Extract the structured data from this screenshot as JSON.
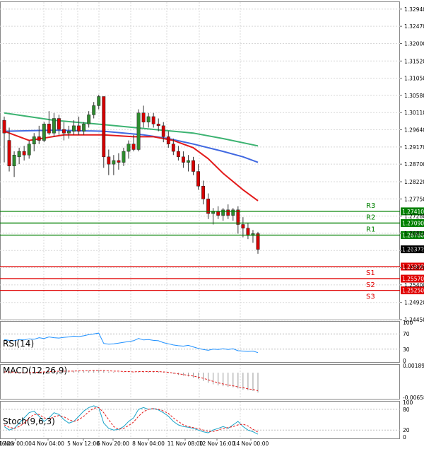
{
  "chart_data": {
    "type": "candlestick",
    "grid": true,
    "price_axis": {
      "ylim": [
        1.2445,
        1.3315
      ],
      "tick_labels": [
        "1.32940",
        "1.32470",
        "1.32000",
        "1.31520",
        "1.31050",
        "1.30580",
        "1.30110",
        "1.29640",
        "1.29170",
        "1.28700",
        "1.28220",
        "1.27750",
        "1.27280",
        "1.26810",
        "1.26340",
        "1.25870",
        "1.25400",
        "1.24920",
        "1.24450"
      ]
    },
    "x_tick_labels": [
      "1 Nov 00:00",
      "4 Nov 04:00",
      "5 Nov 12:00",
      "6 Nov 20:00",
      "8 Nov 04:00",
      "11 Nov 08:00",
      "12 Nov 16:00",
      "14 Nov 00:00"
    ],
    "x_left_partial_label": "16:00",
    "candles": [
      {
        "o": 1.299,
        "h": 1.3,
        "l": 1.2875,
        "c": 1.2955
      },
      {
        "o": 1.2935,
        "h": 1.297,
        "l": 1.285,
        "c": 1.2865
      },
      {
        "o": 1.2865,
        "h": 1.2905,
        "l": 1.2835,
        "c": 1.2895
      },
      {
        "o": 1.289,
        "h": 1.2915,
        "l": 1.287,
        "c": 1.2905
      },
      {
        "o": 1.2905,
        "h": 1.292,
        "l": 1.288,
        "c": 1.2895
      },
      {
        "o": 1.2895,
        "h": 1.2935,
        "l": 1.2885,
        "c": 1.2925
      },
      {
        "o": 1.2925,
        "h": 1.2955,
        "l": 1.2905,
        "c": 1.2945
      },
      {
        "o": 1.2945,
        "h": 1.2975,
        "l": 1.2925,
        "c": 1.2935
      },
      {
        "o": 1.2935,
        "h": 1.2985,
        "l": 1.293,
        "c": 1.298
      },
      {
        "o": 1.298,
        "h": 1.3015,
        "l": 1.295,
        "c": 1.2955
      },
      {
        "o": 1.2955,
        "h": 1.301,
        "l": 1.2945,
        "c": 1.2995
      },
      {
        "o": 1.2995,
        "h": 1.3005,
        "l": 1.295,
        "c": 1.2965
      },
      {
        "o": 1.2965,
        "h": 1.2985,
        "l": 1.2935,
        "c": 1.2955
      },
      {
        "o": 1.2955,
        "h": 1.2975,
        "l": 1.294,
        "c": 1.296
      },
      {
        "o": 1.296,
        "h": 1.299,
        "l": 1.295,
        "c": 1.2975
      },
      {
        "o": 1.2975,
        "h": 1.3,
        "l": 1.295,
        "c": 1.296
      },
      {
        "o": 1.296,
        "h": 1.2985,
        "l": 1.295,
        "c": 1.298
      },
      {
        "o": 1.298,
        "h": 1.3015,
        "l": 1.297,
        "c": 1.3005
      },
      {
        "o": 1.3005,
        "h": 1.304,
        "l": 1.2995,
        "c": 1.303
      },
      {
        "o": 1.303,
        "h": 1.306,
        "l": 1.302,
        "c": 1.3055
      },
      {
        "o": 1.3055,
        "h": 1.3055,
        "l": 1.286,
        "c": 1.289
      },
      {
        "o": 1.289,
        "h": 1.291,
        "l": 1.284,
        "c": 1.287
      },
      {
        "o": 1.287,
        "h": 1.2895,
        "l": 1.284,
        "c": 1.288
      },
      {
        "o": 1.288,
        "h": 1.29,
        "l": 1.2855,
        "c": 1.2875
      },
      {
        "o": 1.2875,
        "h": 1.2915,
        "l": 1.2865,
        "c": 1.2905
      },
      {
        "o": 1.2905,
        "h": 1.2935,
        "l": 1.2885,
        "c": 1.2925
      },
      {
        "o": 1.2925,
        "h": 1.295,
        "l": 1.2905,
        "c": 1.291
      },
      {
        "o": 1.291,
        "h": 1.302,
        "l": 1.2905,
        "c": 1.301
      },
      {
        "o": 1.301,
        "h": 1.303,
        "l": 1.297,
        "c": 1.2985
      },
      {
        "o": 1.2985,
        "h": 1.301,
        "l": 1.297,
        "c": 1.3
      },
      {
        "o": 1.3,
        "h": 1.301,
        "l": 1.297,
        "c": 1.298
      },
      {
        "o": 1.298,
        "h": 1.2995,
        "l": 1.296,
        "c": 1.2975
      },
      {
        "o": 1.2975,
        "h": 1.2985,
        "l": 1.293,
        "c": 1.2945
      },
      {
        "o": 1.2945,
        "h": 1.296,
        "l": 1.2915,
        "c": 1.2925
      },
      {
        "o": 1.2925,
        "h": 1.294,
        "l": 1.2895,
        "c": 1.2905
      },
      {
        "o": 1.2905,
        "h": 1.292,
        "l": 1.288,
        "c": 1.289
      },
      {
        "o": 1.289,
        "h": 1.2905,
        "l": 1.286,
        "c": 1.2875
      },
      {
        "o": 1.2875,
        "h": 1.2895,
        "l": 1.285,
        "c": 1.288
      },
      {
        "o": 1.288,
        "h": 1.289,
        "l": 1.284,
        "c": 1.285
      },
      {
        "o": 1.285,
        "h": 1.287,
        "l": 1.28,
        "c": 1.281
      },
      {
        "o": 1.281,
        "h": 1.2825,
        "l": 1.276,
        "c": 1.2775
      },
      {
        "o": 1.2775,
        "h": 1.279,
        "l": 1.272,
        "c": 1.2735
      },
      {
        "o": 1.2735,
        "h": 1.275,
        "l": 1.2705,
        "c": 1.274
      },
      {
        "o": 1.274,
        "h": 1.2755,
        "l": 1.272,
        "c": 1.273
      },
      {
        "o": 1.273,
        "h": 1.275,
        "l": 1.2715,
        "c": 1.2745
      },
      {
        "o": 1.2745,
        "h": 1.276,
        "l": 1.272,
        "c": 1.273
      },
      {
        "o": 1.273,
        "h": 1.275,
        "l": 1.2715,
        "c": 1.2745
      },
      {
        "o": 1.2745,
        "h": 1.2755,
        "l": 1.268,
        "c": 1.2705
      },
      {
        "o": 1.2705,
        "h": 1.2725,
        "l": 1.267,
        "c": 1.2695
      },
      {
        "o": 1.2695,
        "h": 1.271,
        "l": 1.2665,
        "c": 1.2675
      },
      {
        "o": 1.2675,
        "h": 1.269,
        "l": 1.2655,
        "c": 1.268
      },
      {
        "o": 1.268,
        "h": 1.2685,
        "l": 1.2625,
        "c": 1.2637
      }
    ],
    "moving_averages": [
      {
        "color": "#3cb371",
        "points": [
          [
            0,
            1.301
          ],
          [
            10,
            1.299
          ],
          [
            20,
            1.2978
          ],
          [
            30,
            1.2965
          ],
          [
            38,
            1.2955
          ],
          [
            44,
            1.294
          ],
          [
            51,
            1.292
          ]
        ]
      },
      {
        "color": "#4169e1",
        "points": [
          [
            0,
            1.296
          ],
          [
            10,
            1.2963
          ],
          [
            20,
            1.296
          ],
          [
            28,
            1.295
          ],
          [
            33,
            1.294
          ],
          [
            38,
            1.2925
          ],
          [
            44,
            1.2905
          ],
          [
            48,
            1.289
          ],
          [
            51,
            1.2875
          ]
        ]
      },
      {
        "color": "#e31b1b",
        "points": [
          [
            0,
            1.296
          ],
          [
            5,
            1.2935
          ],
          [
            12,
            1.295
          ],
          [
            20,
            1.295
          ],
          [
            26,
            1.2945
          ],
          [
            30,
            1.2945
          ],
          [
            34,
            1.2935
          ],
          [
            38,
            1.2915
          ],
          [
            41,
            1.2885
          ],
          [
            44,
            1.2845
          ],
          [
            48,
            1.28
          ],
          [
            51,
            1.277
          ]
        ]
      }
    ],
    "levels": [
      {
        "name": "R3",
        "price_label": "1.27410",
        "value": 1.2741,
        "color": "#008000"
      },
      {
        "name": "R2",
        "price_label": "1.27090",
        "value": 1.2709,
        "color": "#008000"
      },
      {
        "name": "R1",
        "price_label": "1.26760",
        "value": 1.2676,
        "color": "#008000"
      },
      {
        "name": "S1",
        "price_label": "1.25900",
        "value": 1.259,
        "color": "#e00000"
      },
      {
        "name": "S2",
        "price_label": "1.25570",
        "value": 1.2557,
        "color": "#e00000"
      },
      {
        "name": "S3",
        "price_label": "1.25250",
        "value": 1.2525,
        "color": "#e00000"
      }
    ],
    "current_price": {
      "label": "1.26372",
      "value": 1.26372
    },
    "rsi": {
      "label": "RSI(14)",
      "ylim": [
        0,
        100
      ],
      "tick_labels": [
        "100",
        "70",
        "30",
        "0"
      ],
      "tick_values": [
        100,
        70,
        30,
        0
      ],
      "values": [
        55,
        53,
        52,
        55,
        54,
        57,
        56,
        60,
        58,
        62,
        60,
        59,
        61,
        62,
        64,
        63,
        65,
        68,
        70,
        72,
        45,
        43,
        44,
        46,
        48,
        50,
        52,
        58,
        54,
        55,
        53,
        52,
        47,
        44,
        41,
        39,
        38,
        40,
        36,
        32,
        29,
        27,
        30,
        29,
        31,
        29,
        31,
        26,
        25,
        24,
        25,
        21
      ]
    },
    "macd": {
      "label": "MACD(12,26,9)",
      "tick_labels": [
        "0.001899",
        "-0.006586"
      ],
      "tick_values": [
        0.001899,
        -0.006586
      ],
      "histogram": [
        0.0003,
        0.0002,
        0.0,
        -0.0001,
        -0.0001,
        0.0,
        0.0001,
        0.0002,
        0.0003,
        0.0004,
        0.0004,
        0.0004,
        0.0004,
        0.0004,
        0.0005,
        0.0005,
        0.0005,
        0.0006,
        0.0007,
        0.0008,
        0.0005,
        0.0003,
        0.0002,
        0.0001,
        0.0001,
        0.0001,
        0.0001,
        0.0003,
        0.0003,
        0.0003,
        0.0003,
        0.0003,
        0.0001,
        -0.0001,
        -0.0003,
        -0.0006,
        -0.0008,
        -0.001,
        -0.0013,
        -0.0017,
        -0.0022,
        -0.0027,
        -0.0031,
        -0.0034,
        -0.0036,
        -0.0038,
        -0.0039,
        -0.0042,
        -0.0045,
        -0.0047,
        -0.0049,
        -0.0053
      ],
      "signal": [
        0.0002,
        0.0002,
        0.0001,
        0.0,
        0.0,
        0.0,
        0.0001,
        0.0001,
        0.0002,
        0.0003,
        0.0003,
        0.0004,
        0.0004,
        0.0004,
        0.0004,
        0.0005,
        0.0005,
        0.0005,
        0.0006,
        0.0006,
        0.0006,
        0.0005,
        0.0004,
        0.0004,
        0.0003,
        0.0003,
        0.0002,
        0.0003,
        0.0003,
        0.0003,
        0.0003,
        0.0003,
        0.0002,
        0.0001,
        -0.0001,
        -0.0003,
        -0.0005,
        -0.0007,
        -0.0009,
        -0.0012,
        -0.0015,
        -0.0019,
        -0.0023,
        -0.0027,
        -0.003,
        -0.0033,
        -0.0035,
        -0.0038,
        -0.004,
        -0.0043,
        -0.0045,
        -0.0048
      ]
    },
    "stoch": {
      "label": "Stoch(9,6,3)",
      "ylim": [
        0,
        100
      ],
      "tick_labels": [
        "100",
        "80",
        "20",
        "0"
      ],
      "tick_values": [
        100,
        80,
        20,
        0
      ],
      "k": [
        30,
        20,
        25,
        40,
        55,
        70,
        75,
        60,
        45,
        55,
        70,
        65,
        50,
        40,
        45,
        60,
        75,
        85,
        90,
        85,
        40,
        25,
        20,
        22,
        30,
        45,
        55,
        80,
        85,
        80,
        82,
        78,
        70,
        60,
        45,
        35,
        30,
        28,
        25,
        20,
        15,
        12,
        20,
        25,
        30,
        25,
        35,
        45,
        30,
        20,
        15,
        8
      ],
      "d": [
        35,
        28,
        25,
        30,
        40,
        55,
        65,
        65,
        55,
        52,
        58,
        62,
        58,
        50,
        45,
        50,
        60,
        73,
        83,
        85,
        70,
        50,
        30,
        22,
        25,
        33,
        43,
        60,
        73,
        80,
        82,
        80,
        75,
        68,
        55,
        45,
        35,
        30,
        27,
        24,
        20,
        16,
        16,
        20,
        25,
        27,
        30,
        35,
        37,
        32,
        22,
        14
      ]
    }
  }
}
